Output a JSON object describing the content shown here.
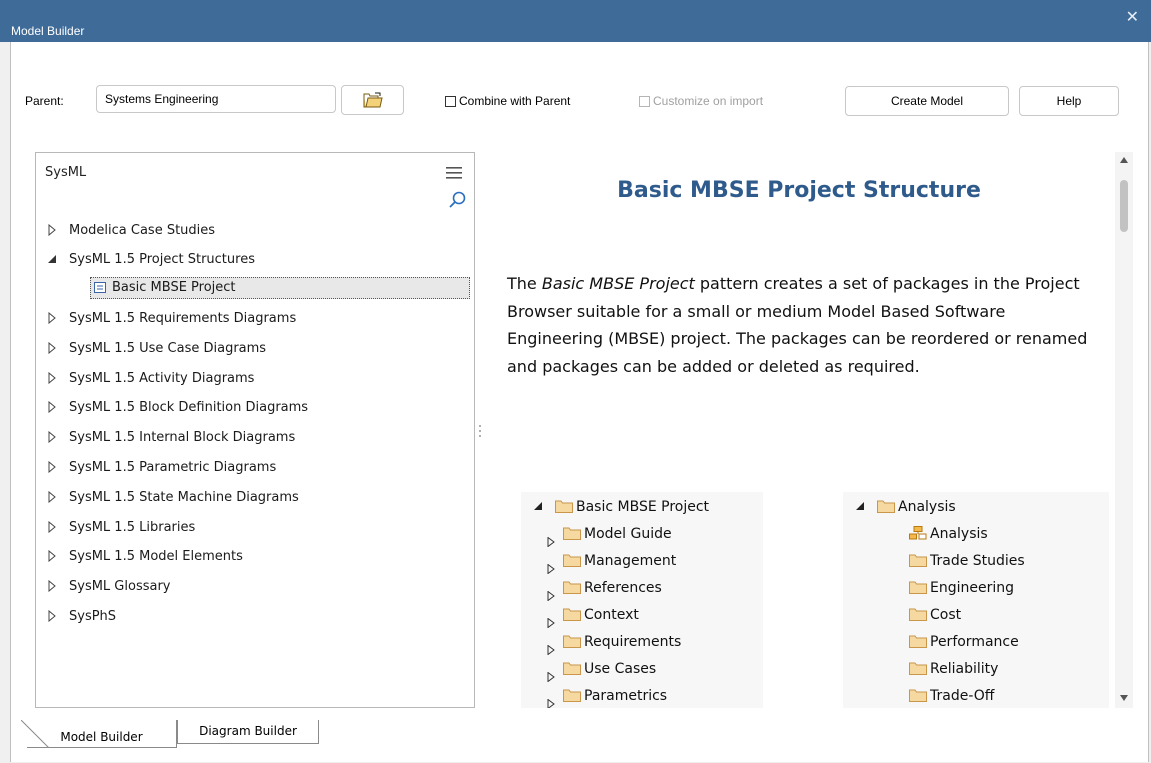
{
  "window": {
    "title": "Model Builder",
    "close_glyph": "✕"
  },
  "toolbar": {
    "parent_label": "Parent:",
    "parent_value": "Systems Engineering",
    "combine_label": "Combine with Parent",
    "combine_checked": false,
    "customize_label": "Customize on import",
    "customize_checked": false,
    "customize_enabled": false,
    "create_label": "Create Model",
    "help_label": "Help"
  },
  "left_panel": {
    "header": "SysML",
    "items": [
      {
        "label": "Modelica Case Studies",
        "expanded": false
      },
      {
        "label": "SysML 1.5 Project Structures",
        "expanded": true
      },
      {
        "label": "Basic MBSE Project",
        "child": true,
        "selected": true
      },
      {
        "label": "SysML 1.5 Requirements Diagrams",
        "expanded": false
      },
      {
        "label": "SysML 1.5 Use Case Diagrams",
        "expanded": false
      },
      {
        "label": "SysML 1.5 Activity Diagrams",
        "expanded": false
      },
      {
        "label": "SysML 1.5 Block Definition Diagrams",
        "expanded": false
      },
      {
        "label": "SysML 1.5 Internal Block Diagrams",
        "expanded": false
      },
      {
        "label": "SysML 1.5 Parametric Diagrams",
        "expanded": false
      },
      {
        "label": "SysML 1.5 State Machine Diagrams",
        "expanded": false
      },
      {
        "label": "SysML 1.5 Libraries",
        "expanded": false
      },
      {
        "label": "SysML 1.5 Model Elements",
        "expanded": false
      },
      {
        "label": "SysML Glossary",
        "expanded": false
      },
      {
        "label": "SysPhS",
        "expanded": false
      }
    ]
  },
  "doc": {
    "title": "Basic MBSE Project Structure",
    "para_pre": "The ",
    "para_em": "Basic MBSE Project",
    "para_post": " pattern creates a set of packages in the Project Browser suitable for a small or medium Model Based Software Engineering (MBSE) project.  The packages can be reordered or renamed and packages can be added or deleted as required.",
    "tree_left": {
      "root": "Basic MBSE Project",
      "children": [
        "Model Guide",
        "Management",
        "References",
        "Context",
        "Requirements",
        "Use Cases",
        "Parametrics"
      ]
    },
    "tree_right": {
      "root": "Analysis",
      "children": [
        "Analysis",
        "Trade Studies",
        "Engineering",
        "Cost",
        "Performance",
        "Reliability",
        "Trade-Off"
      ]
    }
  },
  "tabs": [
    {
      "label": "Model Builder",
      "active": true
    },
    {
      "label": "Diagram Builder",
      "active": false
    }
  ],
  "colors": {
    "titlebar": "#3f6b98",
    "heading": "#2f5b8c",
    "folder": "#e9b96e"
  }
}
